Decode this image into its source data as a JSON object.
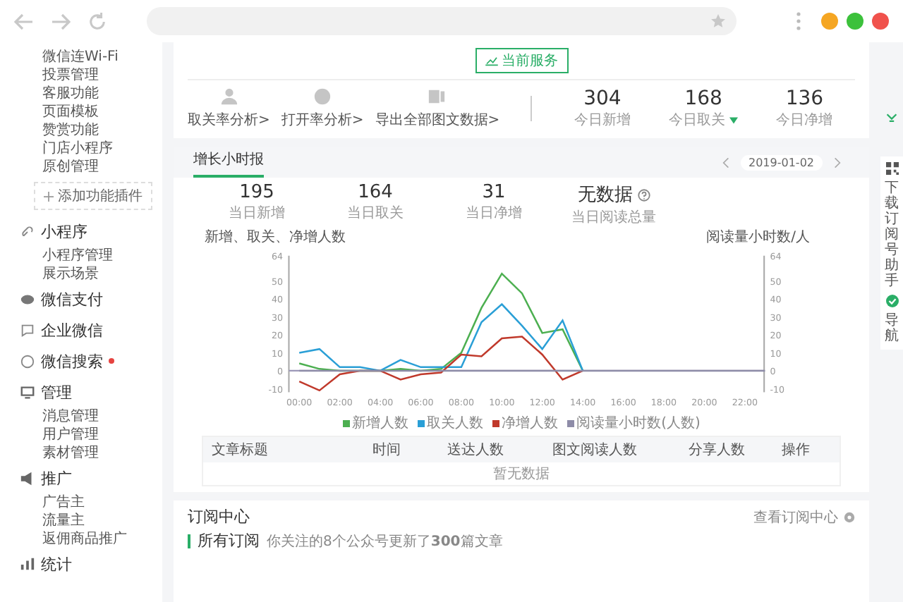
{
  "sidebar": {
    "items": [
      "微信连Wi-Fi",
      "投票管理",
      "客服功能",
      "页面模板",
      "赞赏功能",
      "门店小程序",
      "原创管理"
    ],
    "add_button": "添加功能插件",
    "groups": [
      {
        "title": "小程序",
        "dot": false,
        "items": [
          "小程序管理",
          "展示场景"
        ]
      },
      {
        "title": "微信支付",
        "dot": false
      },
      {
        "title": "企业微信",
        "dot": false
      },
      {
        "title": "微信搜索",
        "dot": true
      },
      {
        "title": "管理",
        "dot": false,
        "items": [
          "消息管理",
          "用户管理",
          "素材管理"
        ]
      },
      {
        "title": "推广",
        "dot": false,
        "items": [
          "广告主",
          "流量主",
          "返佣商品推广"
        ]
      },
      {
        "title": "统计",
        "dot": false
      }
    ]
  },
  "overview": {
    "service_button": "当前服务",
    "links": [
      "取关率分析>",
      "打开率分析>",
      "导出全部图文数据>"
    ],
    "stats": [
      {
        "value": "304",
        "label": "今日新增",
        "down": false
      },
      {
        "value": "168",
        "label": "今日取关",
        "down": true
      },
      {
        "value": "136",
        "label": "今日净增",
        "down": false
      }
    ]
  },
  "growth": {
    "tab": "增长小时报",
    "date": "2019-01-02",
    "stats": [
      {
        "value": "195",
        "label": "当日新增",
        "help": false
      },
      {
        "value": "164",
        "label": "当日取关",
        "help": false
      },
      {
        "value": "31",
        "label": "当日净增",
        "help": false
      },
      {
        "value": "无数据",
        "label": "当日阅读总量",
        "help": true
      }
    ],
    "right_axis_label": "阅读量小时数/人",
    "right_yticks": [
      "64",
      "50",
      "40",
      "30",
      "20",
      "10",
      "0",
      "-10"
    ],
    "chart_data": {
      "type": "line",
      "ylabel": "新增、取关、净增人数",
      "x": [
        0,
        1,
        2,
        3,
        4,
        5,
        6,
        7,
        8,
        9,
        10,
        11,
        12,
        13,
        14,
        15,
        16,
        17,
        18,
        19,
        20,
        21,
        22,
        23
      ],
      "xticks": [
        {
          "value": 0,
          "label": "00:00"
        },
        {
          "value": 2,
          "label": "02:00"
        },
        {
          "value": 4,
          "label": "04:00"
        },
        {
          "value": 6,
          "label": "06:00"
        },
        {
          "value": 8,
          "label": "08:00"
        },
        {
          "value": 10,
          "label": "10:00"
        },
        {
          "value": 12,
          "label": "12:00"
        },
        {
          "value": 14,
          "label": "14:00"
        },
        {
          "value": 16,
          "label": "16:00"
        },
        {
          "value": 18,
          "label": "18:00"
        },
        {
          "value": 20,
          "label": "20:00"
        },
        {
          "value": 22,
          "label": "22:00"
        }
      ],
      "xlim": [
        0,
        23
      ],
      "ylim": [
        -12,
        64
      ],
      "yticks": [
        {
          "value": -10,
          "label": "-10"
        },
        {
          "value": 0,
          "label": "0"
        },
        {
          "value": 10,
          "label": "10"
        },
        {
          "value": 20,
          "label": "20"
        },
        {
          "value": 30,
          "label": "30"
        },
        {
          "value": 40,
          "label": "40"
        },
        {
          "value": 50,
          "label": "50"
        },
        {
          "value": 64,
          "label": "64"
        }
      ],
      "series": [
        {
          "name": "新增人数",
          "color": "#4caf50",
          "values": [
            4,
            1,
            0,
            0,
            0,
            1,
            0,
            1,
            10,
            35,
            54,
            43,
            21,
            23,
            0,
            null,
            null,
            null,
            null,
            null,
            null,
            null,
            null,
            null
          ]
        },
        {
          "name": "取关人数",
          "color": "#2a9fd6",
          "values": [
            10,
            12,
            2,
            2,
            0,
            6,
            2,
            2,
            2,
            27,
            37,
            25,
            12,
            28,
            0,
            null,
            null,
            null,
            null,
            null,
            null,
            null,
            null,
            null
          ]
        },
        {
          "name": "净增人数",
          "color": "#c0392b",
          "values": [
            -6,
            -11,
            -2,
            0,
            0,
            -5,
            -2,
            -1,
            9,
            8,
            18,
            19,
            9,
            -5,
            0,
            null,
            null,
            null,
            null,
            null,
            null,
            null,
            null,
            null
          ]
        },
        {
          "name": "阅读量小时数(人数)",
          "color": "#8e8ca8",
          "values": [
            0,
            0,
            0,
            0,
            0,
            0,
            0,
            0,
            0,
            0,
            0,
            0,
            0,
            0,
            0,
            0,
            0,
            0,
            0,
            0,
            0,
            0,
            0,
            0
          ]
        }
      ]
    },
    "table": {
      "columns": [
        "文章标题",
        "时间",
        "送达人数",
        "图文阅读人数",
        "分享人数",
        "操作"
      ],
      "empty": "暂无数据"
    }
  },
  "subscriptions": {
    "title": "订阅中心",
    "link": "查看订阅中心",
    "tab": "所有订阅",
    "note": "你关注的8个公众号更新了**300**篇文章"
  },
  "float_panel": {
    "download": "下载订阅号助手",
    "nav": "导航"
  }
}
